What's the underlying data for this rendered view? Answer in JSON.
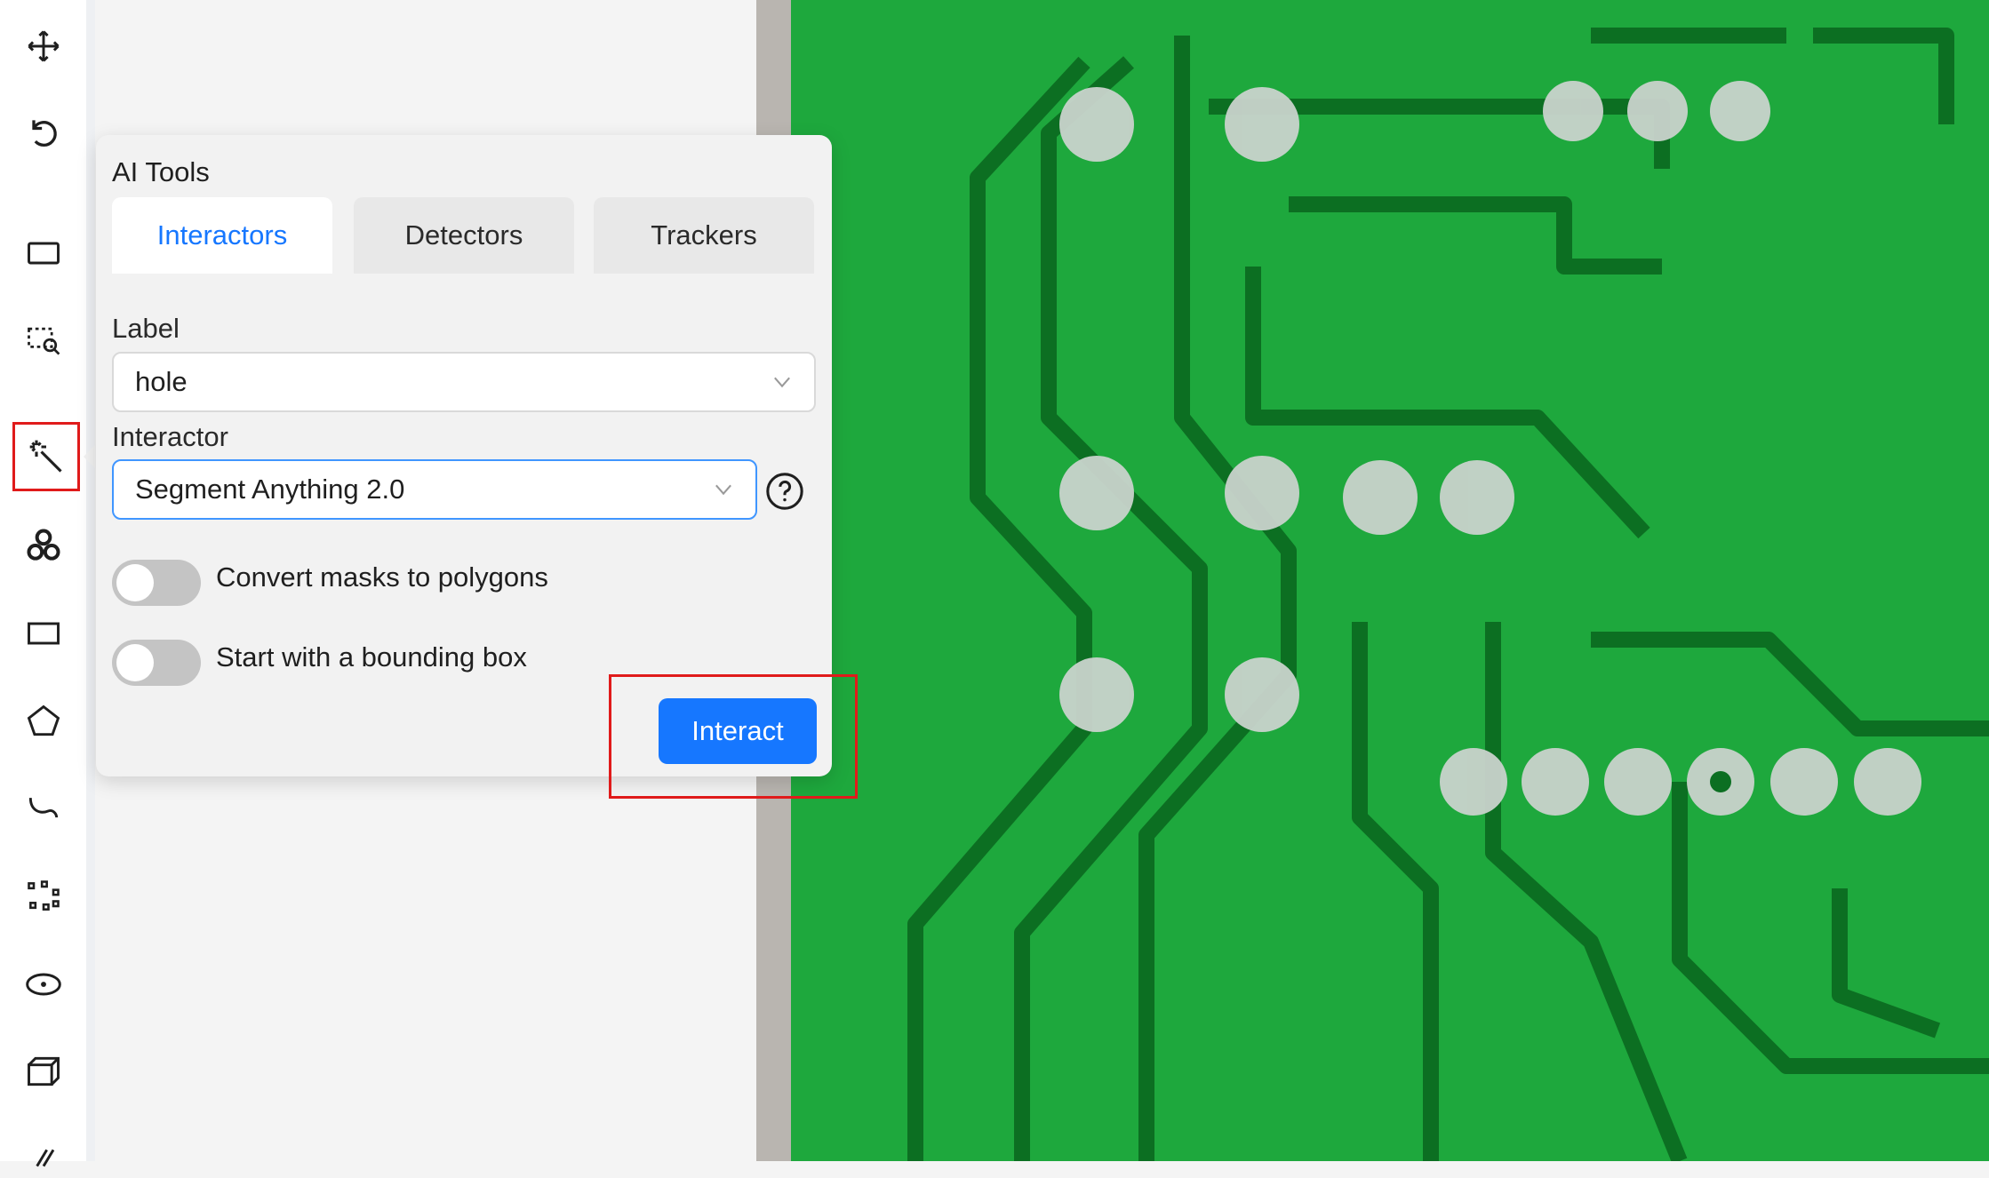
{
  "toolbar": {
    "items": [
      {
        "icon": "move-icon"
      },
      {
        "icon": "undo-icon"
      },
      {
        "icon": "fit-screen-icon"
      },
      {
        "icon": "zoom-region-icon"
      },
      {
        "icon": "magic-wand-icon",
        "active": true
      },
      {
        "icon": "openvino-icon"
      },
      {
        "icon": "rectangle-icon"
      },
      {
        "icon": "polygon-icon"
      },
      {
        "icon": "polyline-icon"
      },
      {
        "icon": "points-icon"
      },
      {
        "icon": "ellipse-icon"
      },
      {
        "icon": "cuboid-icon"
      },
      {
        "icon": "tag-icon"
      }
    ]
  },
  "ai_tools": {
    "title": "AI Tools",
    "tabs": [
      {
        "label": "Interactors",
        "active": true
      },
      {
        "label": "Detectors",
        "active": false
      },
      {
        "label": "Trackers",
        "active": false
      }
    ],
    "label_field": {
      "label": "Label",
      "value": "hole"
    },
    "interactor_field": {
      "label": "Interactor",
      "value": "Segment Anything 2.0"
    },
    "switches": [
      {
        "label": "Convert masks to polygons",
        "checked": false
      },
      {
        "label": "Start with a bounding box",
        "checked": false
      }
    ],
    "interact_label": "Interact"
  },
  "colors": {
    "accent": "#1677ff",
    "highlight": "#e01b1b",
    "pcb_green": "#1aa33a",
    "trace_dark": "#0b6e1f",
    "pad": "#c9d3cc"
  }
}
